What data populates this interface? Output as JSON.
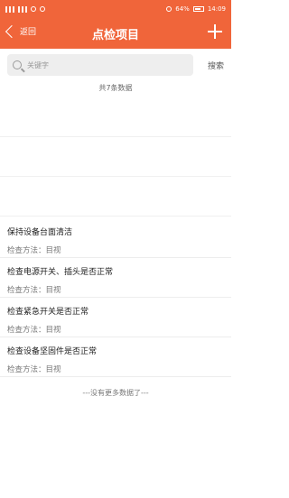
{
  "status_bar": {
    "battery": "64%",
    "time": "14:09"
  },
  "nav": {
    "back_label": "返回",
    "title": "点检项目"
  },
  "search": {
    "placeholder": "关键字",
    "button_label": "搜索"
  },
  "count_text": "共7条数据",
  "items": [
    {
      "name": "保持设备台面清洁",
      "method": "检查方法：目视"
    },
    {
      "name": "检查电源开关、插头是否正常",
      "method": "检查方法：目视"
    },
    {
      "name": "检查紧急开关是否正常",
      "method": "检查方法：目视"
    },
    {
      "name": "检查设备坚固件是否正常",
      "method": "检查方法：目视"
    }
  ],
  "footer_text": "---没有更多数据了---",
  "colors": {
    "accent": "#f0653a"
  }
}
